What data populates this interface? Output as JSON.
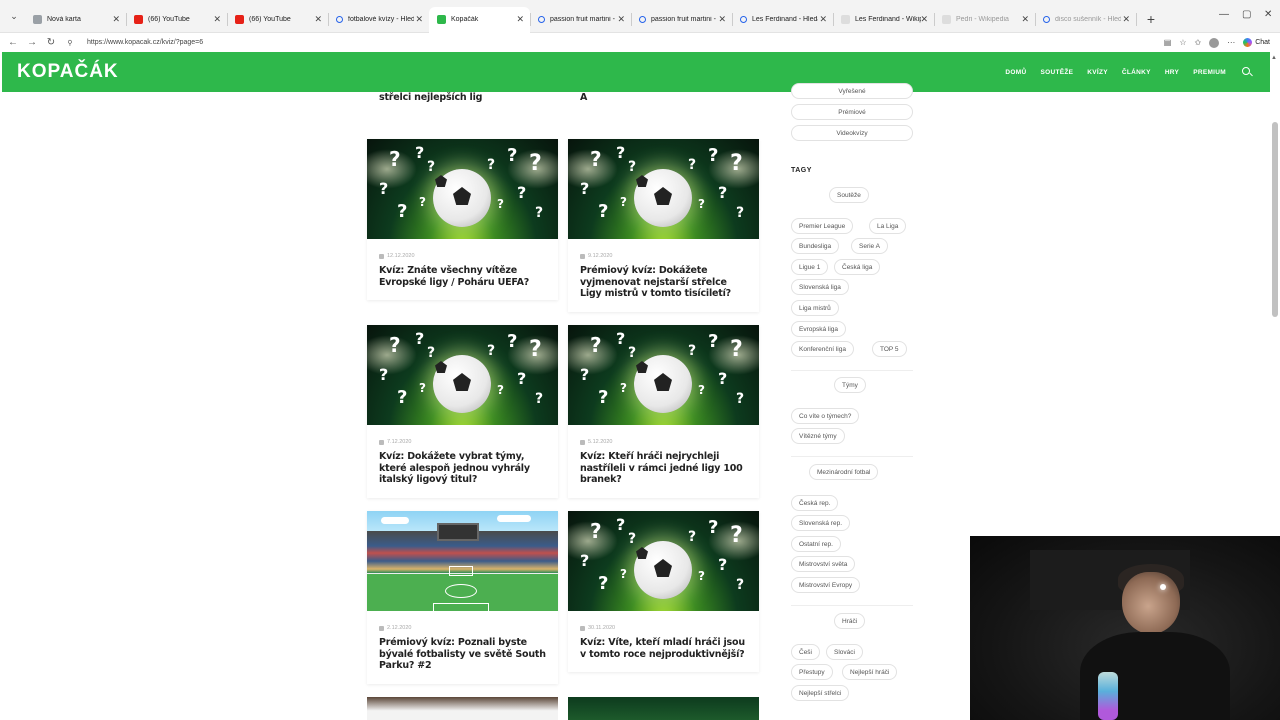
{
  "browser": {
    "tabs": [
      {
        "label": "Nová karta",
        "icon": "page-icon",
        "active": false
      },
      {
        "label": "(66) YouTube",
        "icon": "youtube-icon",
        "active": false
      },
      {
        "label": "(66) YouTube",
        "icon": "youtube-icon",
        "active": false
      },
      {
        "label": "fotbalové kvízy - Hledat",
        "icon": "search-icon",
        "active": false
      },
      {
        "label": "Kopačák",
        "icon": "kopacak-icon",
        "active": true
      },
      {
        "label": "passion fruit martini - Hledat",
        "icon": "search-icon",
        "active": false
      },
      {
        "label": "passion fruit martini - Hledat",
        "icon": "search-icon",
        "active": false
      },
      {
        "label": "Les Ferdinand - Hledat",
        "icon": "search-icon",
        "active": false
      },
      {
        "label": "Les Ferdinand - Wikipedie",
        "icon": "wikipedia-icon",
        "active": false
      },
      {
        "label": "Pedri - Wikipedia",
        "icon": "wikipedia-icon",
        "active": false
      },
      {
        "label": "disco sušenník - Hledat",
        "icon": "search-icon",
        "active": false
      }
    ],
    "url": "https://www.kopacak.cz/kviz/?page=6",
    "chat_label": "Chat"
  },
  "site": {
    "logo": "KOPAČÁK",
    "nav": [
      "DOMŮ",
      "SOUTĚŽE",
      "KVÍZY",
      "ČLÁNKY",
      "HRY",
      "PREMIUM"
    ],
    "brand_color": "#2eb84b"
  },
  "partial_titles": {
    "left": "střelci nejlepších lig",
    "right": "A"
  },
  "cards": [
    {
      "date": "12.12.2020",
      "title": "Kvíz: Znáte všechny vítěze Evropské ligy / Poháru UEFA?",
      "image": "football-question-marks"
    },
    {
      "date": "9.12.2020",
      "title": "Prémiový kvíz: Dokážete vyjmenovat nejstarší střelce Ligy mistrů v tomto tisíciletí?",
      "image": "football-question-marks"
    },
    {
      "date": "7.12.2020",
      "title": "Kvíz: Dokážete vybrat týmy, které alespoň jednou vyhrály italský ligový titul?",
      "image": "football-question-marks"
    },
    {
      "date": "5.12.2020",
      "title": "Kvíz: Kteří hráči nejrychleji nastříleli v rámci jedné ligy 100 branek?",
      "image": "football-question-marks"
    },
    {
      "date": "2.12.2020",
      "title": "Prémiový kvíz: Poznali byste bývalé fotbalisty ve světě South Parku? #2",
      "image": "cartoon-stadium"
    },
    {
      "date": "30.11.2020",
      "title": "Kvíz: Víte, kteří mladí hráči jsou v tomto roce nejproduktivnější?",
      "image": "football-question-marks"
    }
  ],
  "sidebar": {
    "top_pills": [
      "Vyřešené",
      "Prémiové",
      "Videokvízy"
    ],
    "tags_heading": "TAGY",
    "groups": {
      "souteze": "Soutěže",
      "souteze_tags": [
        "Premier League",
        "La Liga",
        "Bundesliga",
        "Serie A",
        "Ligue 1",
        "Česká liga",
        "Slovenská liga",
        "Liga mistrů",
        "Evropská liga",
        "Konferenční liga",
        "TOP 5"
      ],
      "tymy": "Týmy",
      "tymy_tags": [
        "Co víte o týmech?",
        "Vítězné týmy"
      ],
      "mezinarodni": "Mezinárodní fotbal",
      "mezinarodni_tags": [
        "Česká rep.",
        "Slovenská rep.",
        "Ostatní rep.",
        "Mistrovství světa",
        "Mistrovství Evropy"
      ],
      "hraci": "Hráči",
      "hraci_tags": [
        "Češi",
        "Slováci",
        "Přestupy",
        "Nejlepší hráči",
        "Nejlepší střelci"
      ]
    }
  }
}
